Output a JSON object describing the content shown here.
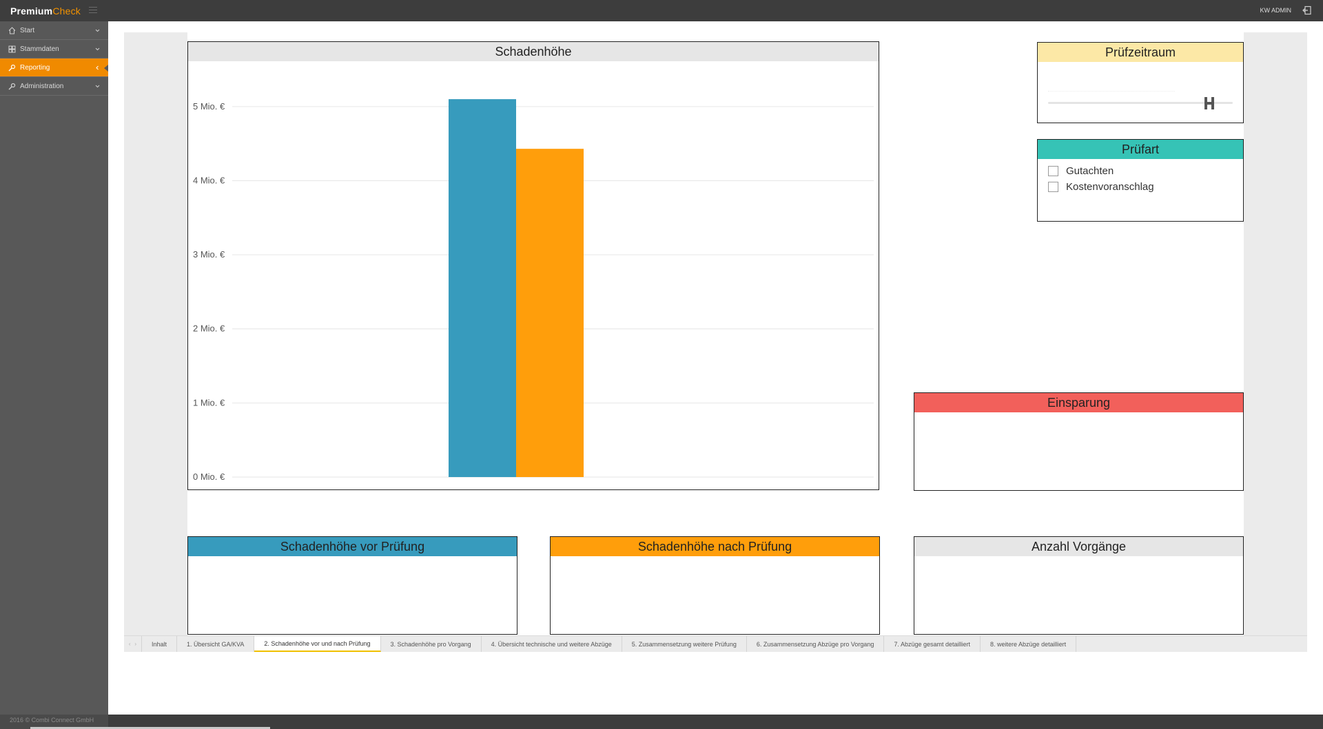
{
  "app": {
    "brand_part1": "Premium",
    "brand_part2": "Check",
    "user": "KW ADMIN",
    "copyright": "2016 © Combi Connect GmbH"
  },
  "sidebar": {
    "items": [
      {
        "label": "Start",
        "icon": "home-icon"
      },
      {
        "label": "Stammdaten",
        "icon": "grid-icon"
      },
      {
        "label": "Reporting",
        "icon": "wrench-icon",
        "active": true
      },
      {
        "label": "Administration",
        "icon": "wrench-icon"
      }
    ]
  },
  "report": {
    "chart_title": "Schadenhöhe",
    "pruefzeitraum_title": "Prüfzeitraum",
    "pruefart_title": "Prüfart",
    "pruefart_options": [
      "Gutachten",
      "Kostenvoranschlag"
    ],
    "einsparung_title": "Einsparung",
    "vor_title": "Schadenhöhe vor Prüfung",
    "nach_title": "Schadenhöhe nach Prüfung",
    "anzahl_title": "Anzahl Vorgänge"
  },
  "chart_data": {
    "type": "bar",
    "title": "Schadenhöhe",
    "xlabel": "",
    "ylabel": "",
    "ylim": [
      0,
      5.5
    ],
    "ytick_labels": [
      "0 Mio. €",
      "1 Mio. €",
      "2 Mio. €",
      "3 Mio. €",
      "4 Mio. €",
      "5 Mio. €"
    ],
    "ytick_values": [
      0,
      1,
      2,
      3,
      4,
      5
    ],
    "categories": [
      ""
    ],
    "series": [
      {
        "color": "#379bbd",
        "values": [
          5.1
        ]
      },
      {
        "color": "#ff9e0b",
        "values": [
          4.43
        ]
      }
    ],
    "grid": true
  },
  "tabs": [
    {
      "label": "Inhalt"
    },
    {
      "label": "1. Übersicht GA/KVA"
    },
    {
      "label": "2. Schadenhöhe vor und nach Prüfung",
      "active": true
    },
    {
      "label": "3. Schadenhöhe pro Vorgang"
    },
    {
      "label": "4. Übersicht technische und weitere Abzüge"
    },
    {
      "label": "5. Zusammensetzung weitere Prüfung"
    },
    {
      "label": "6. Zusammensetzung Abzüge pro Vorgang"
    },
    {
      "label": "7. Abzüge gesamt detailliert"
    },
    {
      "label": "8. weitere Abzüge detailliert"
    }
  ],
  "colors": {
    "accent": "#f08a00",
    "topbar": "#3d3d3d",
    "sidebar": "#585858"
  }
}
